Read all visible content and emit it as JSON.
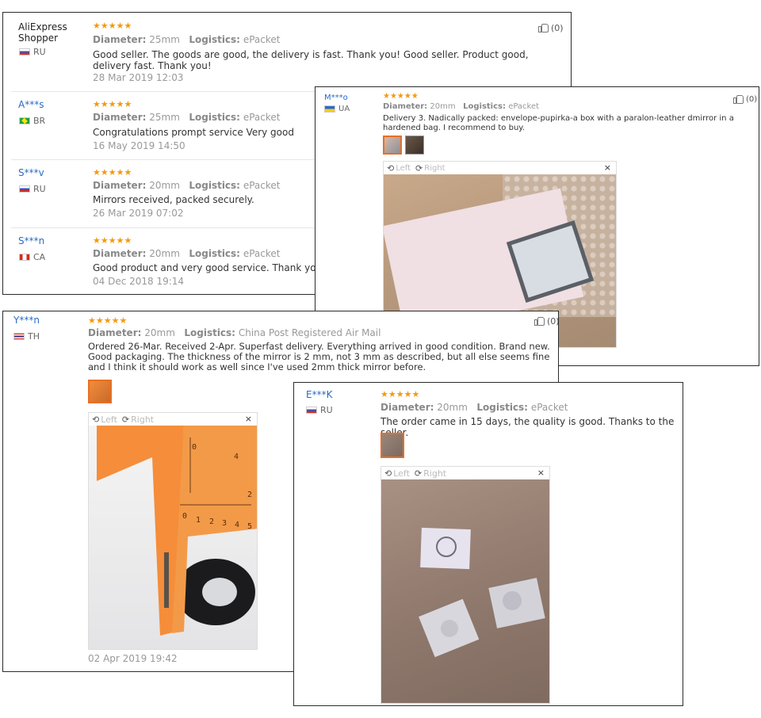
{
  "like_count": "(0)",
  "logistics_label": "Logistics:",
  "diameter_label": "Diameter:",
  "viewer": {
    "left_label": "Left",
    "right_label": "Right",
    "close_label": "×"
  },
  "panel1": {
    "reviews": [
      {
        "user": "AliExpress Shopper",
        "country": "RU",
        "stars": "★★★★★",
        "diameter": "25mm",
        "logistics": "ePacket",
        "text": "Good seller. The goods are good, the delivery is fast. Thank you! Good seller. Product good, delivery fast. Thank you!",
        "date": "28 Mar 2019 12:03"
      },
      {
        "user": "A***s",
        "country": "BR",
        "stars": "★★★★★",
        "diameter": "25mm",
        "logistics": "ePacket",
        "text": "Congratulations prompt service Very good",
        "date": "16 May 2019 14:50"
      },
      {
        "user": "S***v",
        "country": "RU",
        "stars": "★★★★★",
        "diameter": "20mm",
        "logistics": "ePacket",
        "text": "Mirrors received, packed securely.",
        "date": "26 Mar 2019 07:02"
      },
      {
        "user": "S***n",
        "country": "CA",
        "stars": "★★★★★",
        "diameter": "20mm",
        "logistics": "ePacket",
        "text": "Good product and very good service. Thank you",
        "date": "04 Dec 2018 19:14"
      }
    ]
  },
  "panel2": {
    "user": "M***o",
    "country": "UA",
    "stars": "★★★★★",
    "diameter": "20mm",
    "logistics": "ePacket",
    "text": "Delivery 3. Nadically packed: envelope-pupirka-a box with a paralon-leather dmirror in a hardened bag. I recommend to buy."
  },
  "panel3": {
    "user": "Y***n",
    "country": "TH",
    "stars": "★★★★★",
    "diameter": "20mm",
    "logistics": "China Post Registered Air Mail",
    "text": "Ordered 26-Mar. Received 2-Apr. Superfast delivery. Everything arrived in good condition. Brand new. Good packaging. The thickness of the mirror is 2 mm, not 3 mm as described, but all else seems fine and I think it should work as well since I've used 2mm thick mirror before.",
    "date": "02 Apr 2019 19:42"
  },
  "panel4": {
    "user": "E***K",
    "country": "RU",
    "stars": "★★★★★",
    "diameter": "20mm",
    "logistics": "ePacket",
    "text": "The order came in 15 days, the quality is good. Thanks to the seller."
  },
  "caliper_scale": {
    "top": [
      "0",
      "4"
    ],
    "bottom": [
      "0",
      "1",
      "2",
      "3",
      "4",
      "5"
    ],
    "right": [
      "2"
    ]
  }
}
